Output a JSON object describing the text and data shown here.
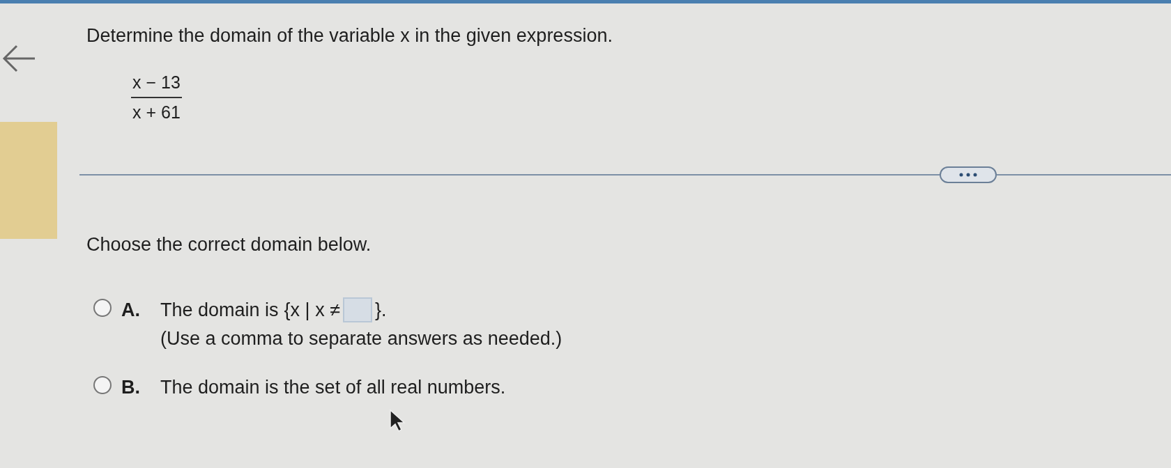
{
  "question": {
    "prompt": "Determine the domain of the variable x in the given expression.",
    "expression": {
      "numerator": "x − 13",
      "denominator": "x + 61"
    }
  },
  "instruction": "Choose the correct domain below.",
  "options": [
    {
      "kind": "answer_box",
      "letter": "A.",
      "before": "The domain is",
      "set_open": "{x | x ≠",
      "set_close": "}.",
      "note": "(Use a comma to separate answers as needed.)",
      "selected": false
    },
    {
      "kind": "plain",
      "letter": "B.",
      "text": "The domain is the set of all real numbers.",
      "selected": false
    }
  ]
}
